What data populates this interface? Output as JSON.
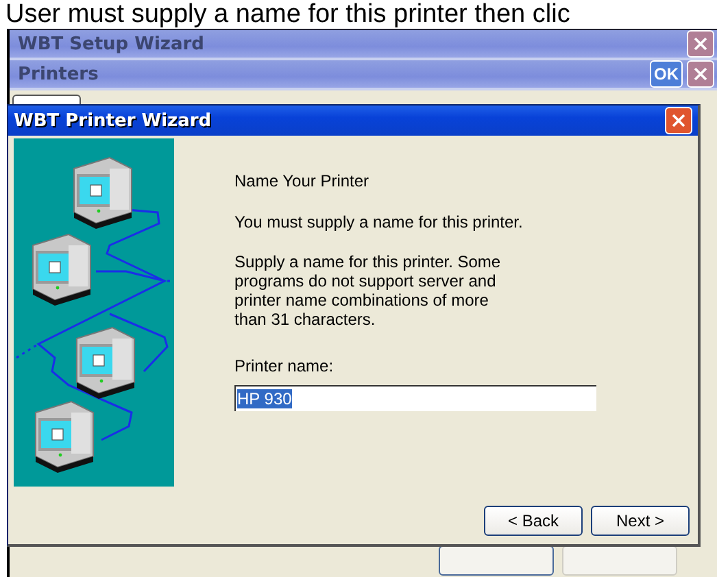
{
  "caption": "User must supply a name for this printer then clic",
  "setup_window": {
    "title": "WBT Setup Wizard"
  },
  "printers_window": {
    "title": "Printers",
    "ok_button": "OK"
  },
  "wizard": {
    "title": "WBT Printer Wizard",
    "heading": "Name Your Printer",
    "message": "You must supply a name for this printer.",
    "description": "Supply a name for this printer. Some\nprograms do not support server and\nprinter name combinations of more\nthan 31 characters.",
    "field_label": "Printer name:",
    "field_value": "HP 930",
    "value_selected": true,
    "buttons": [
      {
        "label": "< Back"
      },
      {
        "label": "Next >"
      }
    ]
  }
}
